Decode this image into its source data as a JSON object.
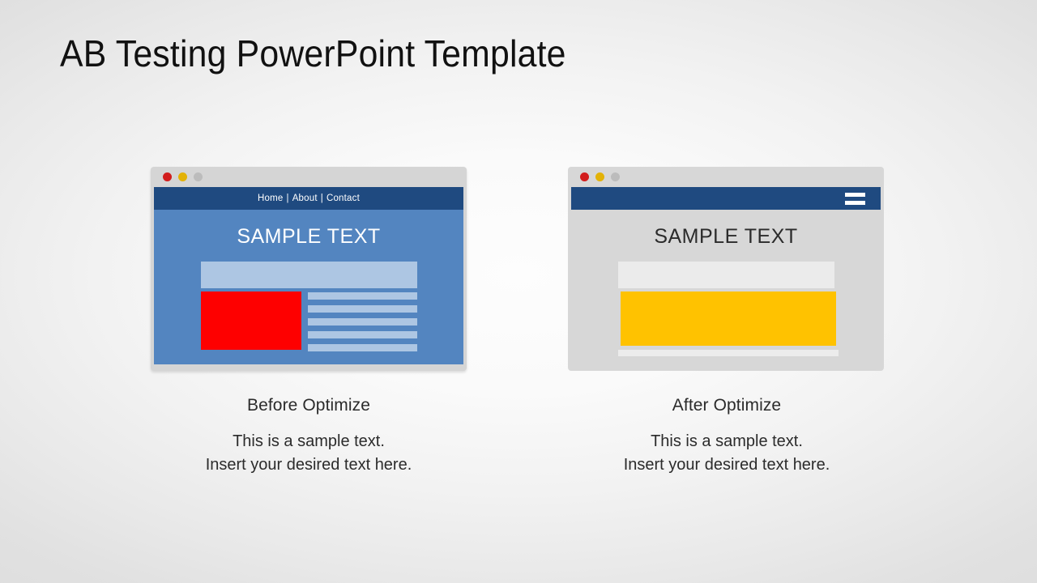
{
  "slide": {
    "title": "AB Testing PowerPoint Template",
    "background_color": "#f5f5f5"
  },
  "panels": [
    {
      "id": "before",
      "caption_heading": "Before Optimize",
      "caption_line1": "This is a sample text.",
      "caption_line2": "Insert your desired text here.",
      "browser": {
        "traffic_lights": [
          "red",
          "yellow",
          "gray"
        ],
        "traffic_light_colors": [
          "#d21d1d",
          "#e3b207",
          "#bcbcbc"
        ],
        "nav_type": "links",
        "nav_items": [
          "Home",
          "About",
          "Contact"
        ],
        "nav_separator": "|",
        "nav_bar_color": "#1f4a80",
        "page_background": "#5385c0",
        "headline": "SAMPLE TEXT",
        "headline_color": "#ffffff",
        "hero_bar_color": "#adc6e3",
        "media_block_color": "#fe0000",
        "text_line_color": "#adc6e3",
        "text_line_count": 5
      }
    },
    {
      "id": "after",
      "caption_heading": "After Optimize",
      "caption_line1": "This is a sample text.",
      "caption_line2": "Insert your desired text here.",
      "browser": {
        "traffic_lights": [
          "red",
          "yellow",
          "gray"
        ],
        "traffic_light_colors": [
          "#d21d1d",
          "#e3b207",
          "#bcbcbc"
        ],
        "nav_type": "hamburger",
        "nav_bar_color": "#1f4a80",
        "page_background": "#d7d7d7",
        "headline": "SAMPLE TEXT",
        "headline_color": "#2b2b2b",
        "hero_bar_color": "#ebebeb",
        "cta_block_color": "#ffc200",
        "footer_strip_color": "#ececec",
        "hamburger_bar_count": 2
      }
    }
  ]
}
